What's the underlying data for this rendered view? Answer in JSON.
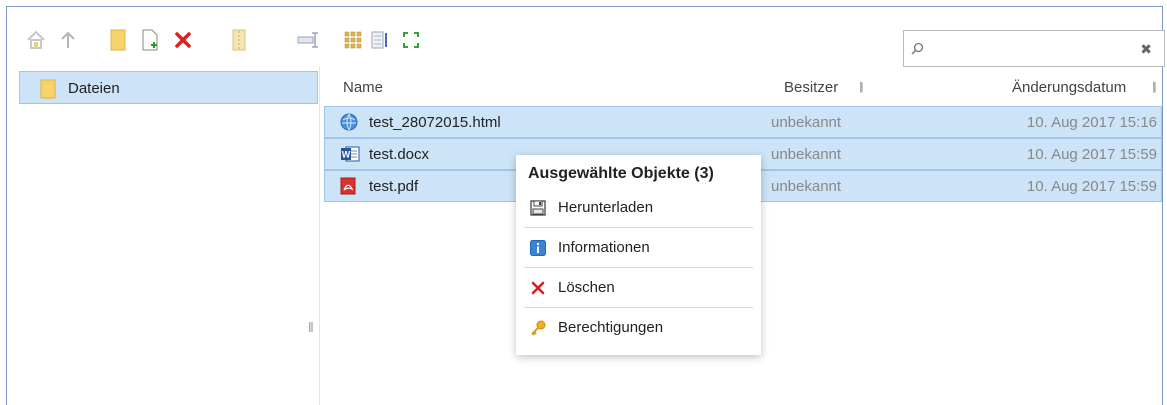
{
  "toolbar": {
    "icons": [
      "home-icon",
      "up-arrow-icon",
      "new-folder-icon",
      "new-file-icon",
      "delete-icon",
      "archive-icon",
      "rename-icon",
      "grid-view-icon",
      "list-view-icon",
      "fullscreen-icon"
    ]
  },
  "search": {
    "value": "",
    "placeholder": ""
  },
  "sidebar": {
    "items": [
      {
        "label": "Dateien"
      }
    ]
  },
  "columns": {
    "name": "Name",
    "owner": "Besitzer",
    "date": "Änderungsdatum"
  },
  "files": [
    {
      "name": "test_28072015.html",
      "owner": "unbekannt",
      "date": "10. Aug 2017 15:16",
      "icon": "web-icon"
    },
    {
      "name": "test.docx",
      "owner": "unbekannt",
      "date": "10. Aug 2017 15:59",
      "icon": "word-icon"
    },
    {
      "name": "test.pdf",
      "owner": "unbekannt",
      "date": "10. Aug 2017 15:59",
      "icon": "pdf-icon"
    }
  ],
  "context_menu": {
    "title": "Ausgewählte Objekte (3)",
    "items": [
      {
        "label": "Herunterladen",
        "icon": "save-icon"
      },
      {
        "label": "Informationen",
        "icon": "info-icon"
      },
      {
        "label": "Löschen",
        "icon": "delete-icon"
      },
      {
        "label": "Berechtigungen",
        "icon": "key-icon"
      }
    ]
  },
  "colors": {
    "selection": "#cde4f8",
    "selection_border": "#9fc6ea",
    "frame": "#7a98c8",
    "delete": "#e02020"
  }
}
